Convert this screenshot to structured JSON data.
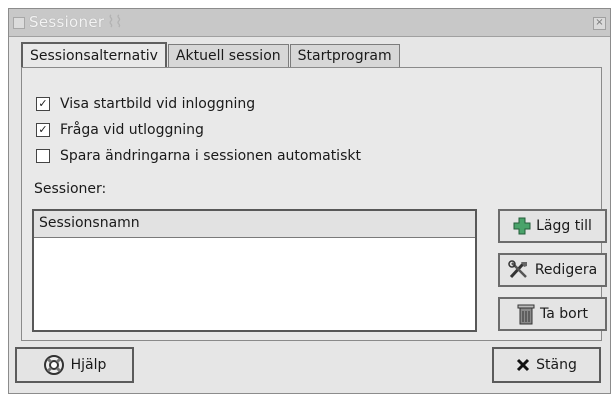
{
  "window": {
    "title": "Sessioner",
    "close_glyph": "×"
  },
  "tabs": [
    {
      "label": "Sessionsalternativ",
      "active": true
    },
    {
      "label": "Aktuell session",
      "active": false
    },
    {
      "label": "Startprogram",
      "active": false
    }
  ],
  "options": [
    {
      "label": "Visa startbild vid inloggning",
      "checked": true
    },
    {
      "label": "Fråga vid utloggning",
      "checked": true
    },
    {
      "label": "Spara ändringarna i sessionen automatiskt",
      "checked": false
    }
  ],
  "sessions": {
    "label": "Sessioner:",
    "column_header": "Sessionsnamn",
    "rows": []
  },
  "side_buttons": {
    "add": {
      "label": "Lägg till",
      "icon": "plus-icon"
    },
    "edit": {
      "label": "Redigera",
      "icon": "tools-icon"
    },
    "remove": {
      "label": "Ta bort",
      "icon": "trash-icon"
    }
  },
  "footer": {
    "help": {
      "label": "Hjälp",
      "icon": "lifebuoy-icon"
    },
    "close": {
      "label": "Stäng",
      "icon": "x-icon"
    }
  },
  "check_glyph": "✓",
  "colors": {
    "title_bar": "#c8c8c8",
    "background": "#e6e6e6",
    "plus": "#2e7d4a"
  }
}
